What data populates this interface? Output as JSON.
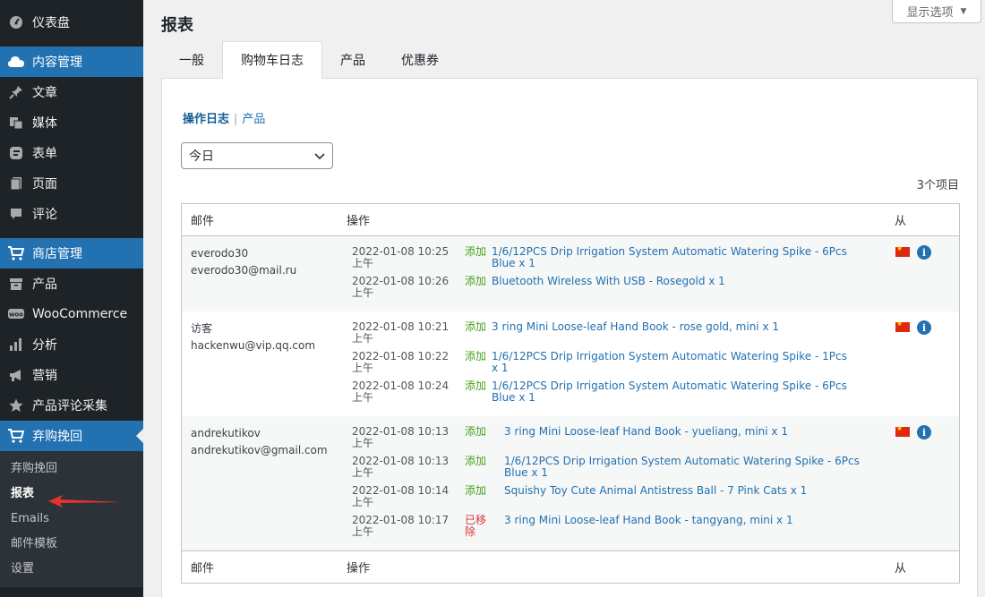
{
  "sidebar": {
    "dashboard": "仪表盘",
    "content": "内容管理",
    "posts": "文章",
    "media": "媒体",
    "forms": "表单",
    "pages": "页面",
    "comments": "评论",
    "shop": "商店管理",
    "products": "产品",
    "woocommerce": "WooCommerce",
    "analytics": "分析",
    "marketing": "营销",
    "reviews": "产品评论采集",
    "abandoned": "弃购挽回",
    "submenu": [
      "弃购挽回",
      "报表",
      "Emails",
      "邮件模板",
      "设置"
    ]
  },
  "header": {
    "title": "报表",
    "screen_options": "显示选项"
  },
  "tabs": [
    "一般",
    "购物车日志",
    "产品",
    "优惠券"
  ],
  "subnav": {
    "current": "操作日志",
    "sep": "|",
    "other": "产品"
  },
  "filter": {
    "selected": "今日"
  },
  "count": "3个项目",
  "table": {
    "col_email": "邮件",
    "col_action": "操作",
    "col_from": "从",
    "rows": [
      {
        "name": "everodo30",
        "email": "everodo30@mail.ru",
        "entries": [
          {
            "time": "2022-01-08 10:25 上午",
            "action": "添加",
            "product": "1/6/12PCS Drip Irrigation System Automatic Watering Spike - 6Pcs Blue x 1"
          },
          {
            "time": "2022-01-08 10:26 上午",
            "action": "添加",
            "product": "Bluetooth Wireless With USB - Rosegold x 1"
          }
        ]
      },
      {
        "name": "访客",
        "email": "hackenwu@vip.qq.com",
        "entries": [
          {
            "time": "2022-01-08 10:21 上午",
            "action": "添加",
            "product": "3 ring Mini Loose-leaf Hand Book - rose gold, mini x 1"
          },
          {
            "time": "2022-01-08 10:22 上午",
            "action": "添加",
            "product": "1/6/12PCS Drip Irrigation System Automatic Watering Spike - 1Pcs x 1"
          },
          {
            "time": "2022-01-08 10:24 上午",
            "action": "添加",
            "product": "1/6/12PCS Drip Irrigation System Automatic Watering Spike - 6Pcs Blue x 1"
          }
        ]
      },
      {
        "name": "andrekutikov",
        "email": "andrekutikov@gmail.com",
        "entries": [
          {
            "time": "2022-01-08 10:13 上午",
            "action": "添加",
            "product": "3 ring Mini Loose-leaf Hand Book - yueliang, mini x 1"
          },
          {
            "time": "2022-01-08 10:13 上午",
            "action": "添加",
            "product": "1/6/12PCS Drip Irrigation System Automatic Watering Spike - 6Pcs Blue x 1"
          },
          {
            "time": "2022-01-08 10:14 上午",
            "action": "添加",
            "product": "Squishy Toy Cute Animal Antistress Ball - 7 Pink Cats x 1"
          },
          {
            "time": "2022-01-08 10:17 上午",
            "action": "已移除",
            "product": "3 ring Mini Loose-leaf Hand Book - tangyang, mini x 1"
          }
        ]
      }
    ]
  },
  "colors": {
    "sidebar_bg": "#1d2327",
    "accent": "#2271b1",
    "added": "#46a31a",
    "removed": "#d63638",
    "arrow": "#e8322e"
  }
}
